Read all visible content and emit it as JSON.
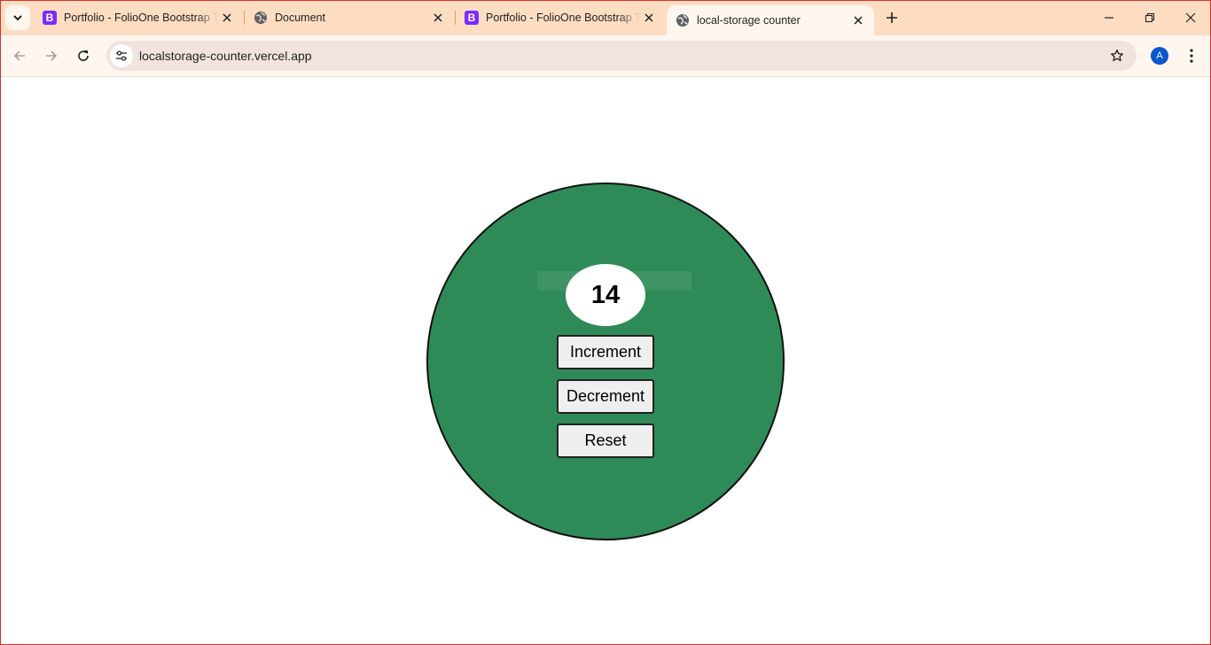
{
  "browser": {
    "tabs": [
      {
        "title": "Portfolio - FolioOne Bootstrap Template",
        "favicon": "bootstrap-icon",
        "favicon_letter": "B"
      },
      {
        "title": "Document",
        "favicon": "globe-icon"
      },
      {
        "title": "Portfolio - FolioOne Bootstrap Template",
        "favicon": "bootstrap-icon",
        "favicon_letter": "B"
      },
      {
        "title": "local-storage counter",
        "favicon": "globe-icon",
        "active": true
      }
    ],
    "url": "localstorage-counter.vercel.app",
    "profile_initial": "A",
    "colors": {
      "tabstrip": "#fdddc2",
      "toolbar": "#fff6ef",
      "omnibox": "#f1e4de",
      "profile": "#0b57d0"
    }
  },
  "app": {
    "count": "14",
    "buttons": {
      "increment": "Increment",
      "decrement": "Decrement",
      "reset": "Reset"
    },
    "colors": {
      "circle": "#2e8b57",
      "counter_bg": "#ffffff",
      "button_bg": "#efefef"
    }
  }
}
